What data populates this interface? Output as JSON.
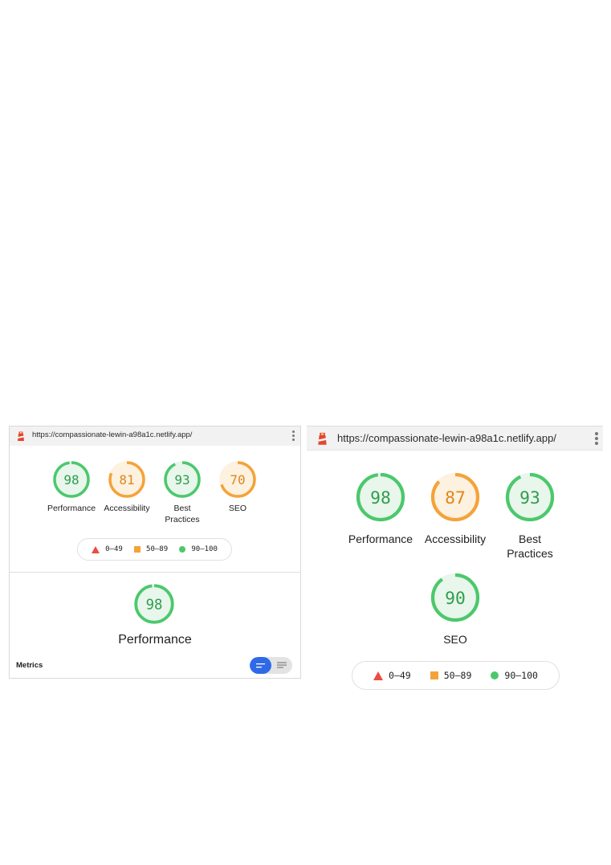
{
  "colors": {
    "pass": "#4cc86c",
    "pass_track": "#e8f6ec",
    "pass_text": "#2f9e4c",
    "average": "#f4a33a",
    "average_track": "#fdf1e0",
    "average_text": "#e0871b",
    "fail": "#eb4c45",
    "toggle_active": "#2e6ae8"
  },
  "left_report": {
    "url": "https://compassionate-lewin-a98a1c.netlify.app/",
    "scores": [
      {
        "label": "Performance",
        "score": 98,
        "rating": "pass"
      },
      {
        "label": "Accessibility",
        "score": 81,
        "rating": "average"
      },
      {
        "label": "Best Practices",
        "score": 93,
        "rating": "pass"
      },
      {
        "label": "SEO",
        "score": 70,
        "rating": "average"
      }
    ],
    "legend": [
      "0–49",
      "50–89",
      "90–100"
    ],
    "performance_section": {
      "score": 98,
      "rating": "pass",
      "title": "Performance"
    },
    "metrics_label": "Metrics"
  },
  "right_report": {
    "url": "https://compassionate-lewin-a98a1c.netlify.app/",
    "scores": [
      {
        "label": "Performance",
        "score": 98,
        "rating": "pass"
      },
      {
        "label": "Accessibility",
        "score": 87,
        "rating": "average"
      },
      {
        "label": "Best Practices",
        "score": 93,
        "rating": "pass"
      },
      {
        "label": "SEO",
        "score": 90,
        "rating": "pass"
      }
    ],
    "legend": [
      "0–49",
      "50–89",
      "90–100"
    ]
  }
}
